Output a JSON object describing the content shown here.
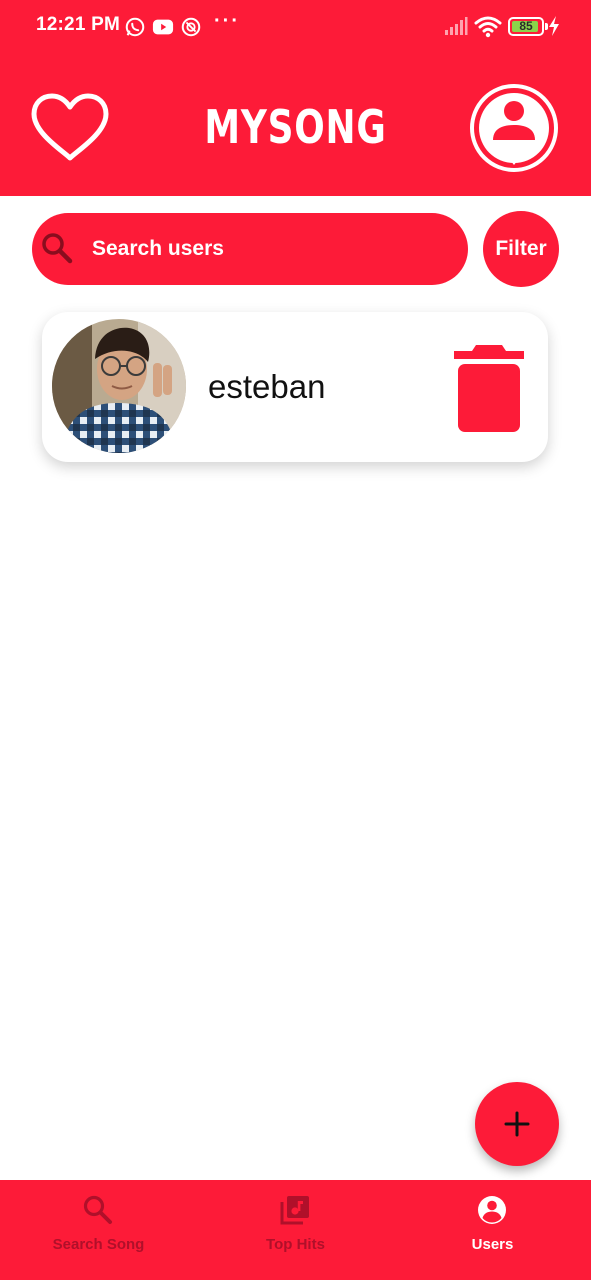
{
  "status_bar": {
    "time": "12:21 PM",
    "battery_level": "85",
    "icons": [
      "whatsapp-icon",
      "youtube-icon",
      "notification-app-icon",
      "more-dots-icon",
      "signal-icon",
      "wifi-icon",
      "battery-icon",
      "charging-icon"
    ]
  },
  "app_bar": {
    "title": "MYSONG",
    "left_icon": "heart-icon",
    "right_icon": "user-profile-icon"
  },
  "search": {
    "placeholder": "Search users",
    "value": "",
    "filter_label": "Filter"
  },
  "users": [
    {
      "name": "esteban",
      "avatar": "user-photo",
      "action_icon": "trash-icon"
    }
  ],
  "fab": {
    "icon": "plus-icon"
  },
  "bottom_nav": {
    "items": [
      {
        "label": "Search Song",
        "icon": "search-icon",
        "active": false
      },
      {
        "label": "Top Hits",
        "icon": "music-library-icon",
        "active": false
      },
      {
        "label": "Users",
        "icon": "account-icon",
        "active": true
      }
    ]
  },
  "colors": {
    "primary": "#fd1b38",
    "nav_inactive": "#b0102a",
    "dark_icon": "#8a0d1e",
    "white": "#ffffff"
  }
}
